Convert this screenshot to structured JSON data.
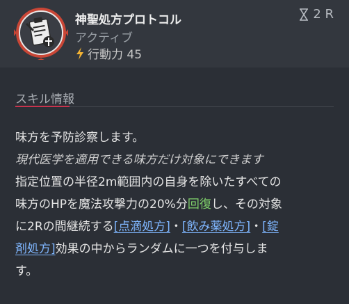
{
  "skill": {
    "title": "神聖処方プロトコル",
    "status": "アクティブ",
    "cost_label": "行動力 45",
    "cooldown": "2 R",
    "icon": "prescription-clipboard-icon"
  },
  "section": {
    "title": "スキル情報"
  },
  "description": {
    "line1": "味方を予防診察します。",
    "line2": "現代医学を適用できる味方だけ対象にできます",
    "line3": "指定位置の半径2m範囲内の自身を除いたすべての",
    "line4_a": "味方のHPを魔法攻撃力の20%分",
    "line4_green": "回復",
    "line4_b": "し、その対象",
    "line5_a": "に2Rの間継続する",
    "link1": "[点滴処方]",
    "sep1": "・",
    "link2": "[飲み薬処方]",
    "sep2": "・",
    "link3a": "[錠",
    "link3b": "剤処方]",
    "line6_b": "効果の中からランダムに一つを付与しま",
    "line7": "す。"
  },
  "colors": {
    "background": "#2b2f36",
    "header": "#33373e",
    "accent_red": "#c8334d",
    "link": "#7fb6ff",
    "heal_green": "#7fd06a"
  }
}
